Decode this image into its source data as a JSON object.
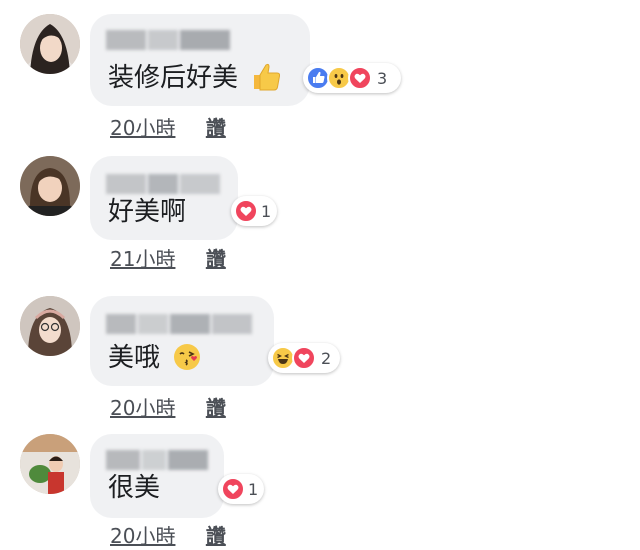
{
  "comments": [
    {
      "text": "装修后好美",
      "emoji": "thumbs-up",
      "reaction_count": "3",
      "time": "20小時",
      "like_label": "讚"
    },
    {
      "text": "好美啊",
      "emoji": "",
      "reaction_count": "1",
      "time": "21小時",
      "like_label": "讚"
    },
    {
      "text": "美哦",
      "emoji": "kissing-face",
      "reaction_count": "2",
      "time": "20小時",
      "like_label": "讚"
    },
    {
      "text": "很美",
      "emoji": "",
      "reaction_count": "1",
      "time": "20小時",
      "like_label": "讚"
    }
  ],
  "colors": {
    "bubble": "#f0f1f3",
    "like_blue": "#4a7cf0",
    "love_red": "#f0455d",
    "haha_yellow": "#f7c948"
  }
}
